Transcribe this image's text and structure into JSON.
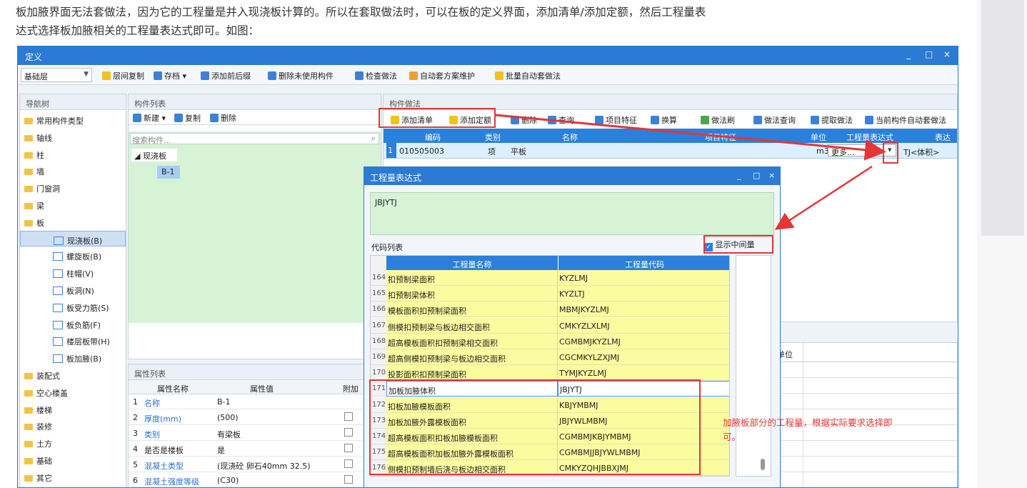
{
  "intro": {
    "line1": "板加腋界面无法套做法，因为它的工程量是并入现浇板计算的。所以在套取做法时，可以在板的定义界面，添加清单/添加定额，然后工程量表",
    "line2": "达式选择板加腋相关的工程量表达式即可。如图："
  },
  "window": {
    "title": "定义",
    "controls": [
      "_",
      "□",
      "×"
    ]
  },
  "toolbar": {
    "floor": "基础层",
    "items": [
      "层间复制",
      "存档",
      "添加前后缀",
      "删除未使用构件",
      "检查做法",
      "自动套方案维护",
      "批量自动套做法"
    ]
  },
  "nav": {
    "title": "导航树",
    "items": [
      {
        "label": "常用构件类型",
        "level": 0
      },
      {
        "label": "轴线",
        "level": 0
      },
      {
        "label": "柱",
        "level": 0
      },
      {
        "label": "墙",
        "level": 0
      },
      {
        "label": "门窗洞",
        "level": 0
      },
      {
        "label": "梁",
        "level": 0
      },
      {
        "label": "板",
        "level": 0
      },
      {
        "label": "现浇板(B)",
        "level": 1,
        "selected": true
      },
      {
        "label": "螺旋板(B)",
        "level": 1
      },
      {
        "label": "柱帽(V)",
        "level": 1
      },
      {
        "label": "板洞(N)",
        "level": 1
      },
      {
        "label": "板受力筋(S)",
        "level": 1
      },
      {
        "label": "板负筋(F)",
        "level": 1
      },
      {
        "label": "楼层板带(H)",
        "level": 1
      },
      {
        "label": "板加腋(B)",
        "level": 1
      },
      {
        "label": "装配式",
        "level": 0
      },
      {
        "label": "空心楼盖",
        "level": 0
      },
      {
        "label": "楼梯",
        "level": 0
      },
      {
        "label": "装修",
        "level": 0
      },
      {
        "label": "土方",
        "level": 0
      },
      {
        "label": "基础",
        "level": 0
      },
      {
        "label": "其它",
        "level": 0
      }
    ]
  },
  "complist": {
    "title": "构件列表",
    "new": "新建",
    "copy": "复制",
    "delete": "删除",
    "search_placeholder": "搜索构件...",
    "group": "现浇板",
    "item": "B-1"
  },
  "props": {
    "title": "属性列表",
    "headers": [
      "属性名称",
      "属性值",
      "附加"
    ],
    "rows": [
      {
        "no": "1",
        "name": "名称",
        "value": "B-1",
        "link": true,
        "check": false
      },
      {
        "no": "2",
        "name": "厚度(mm)",
        "value": "(500)",
        "link": true,
        "check": true
      },
      {
        "no": "3",
        "name": "类别",
        "value": "有梁板",
        "link": true,
        "check": true
      },
      {
        "no": "4",
        "name": "是否是楼板",
        "value": "是",
        "link": false,
        "check": true
      },
      {
        "no": "5",
        "name": "混凝土类型",
        "value": "(现浇砼 卵石40mm 32.5)",
        "link": true,
        "check": true
      },
      {
        "no": "6",
        "name": "混凝土强度等级",
        "value": "(C30)",
        "link": true,
        "check": true
      }
    ]
  },
  "method": {
    "title": "构件做法",
    "toolbar": [
      "添加清单",
      "添加定额",
      "删除",
      "查询",
      "项目特征",
      "换算",
      "做法刷",
      "做法查询",
      "提取做法",
      "当前构件自动套做法"
    ],
    "headers": [
      "编码",
      "类别",
      "名称",
      "项目特征",
      "单位",
      "工程量表达式",
      "表达式"
    ],
    "row": {
      "no": "1",
      "code": "010505003",
      "type": "项",
      "name": "平板",
      "unit": "m3",
      "expr": "更多...",
      "expr_desc": "TJ<体积>"
    },
    "lower_header": "单位"
  },
  "dialog": {
    "title": "工程量表达式",
    "expr": "JBJYTJ",
    "list_label": "代码列表",
    "show_mid": "显示中间量",
    "headers": [
      "工程量名称",
      "工程量代码"
    ],
    "rows": [
      {
        "no": "164",
        "name": "扣预制梁面积",
        "code": "KYZLMJ"
      },
      {
        "no": "165",
        "name": "扣预制梁体积",
        "code": "KYZLTJ"
      },
      {
        "no": "166",
        "name": "模板面积扣预制梁面积",
        "code": "MBMJKYZLMJ"
      },
      {
        "no": "167",
        "name": "侧模扣预制梁与板边相交面积",
        "code": "CMKYZLXLMJ"
      },
      {
        "no": "168",
        "name": "超高模板面积扣预制梁相交面积",
        "code": "CGMBMJKYZLMJ"
      },
      {
        "no": "169",
        "name": "超高侧模扣预制梁与板边相交面积",
        "code": "CGCMKYLZXJMJ"
      },
      {
        "no": "170",
        "name": "投影面积扣预制梁面积",
        "code": "TYMJKYZLMJ"
      },
      {
        "no": "171",
        "name": "加板加腋体积",
        "code": "JBJYTJ",
        "selected": true
      },
      {
        "no": "172",
        "name": "扣板加腋模板面积",
        "code": "KBJYMBMJ"
      },
      {
        "no": "173",
        "name": "加板加腋外露模板面积",
        "code": "JBJYWLMBMJ"
      },
      {
        "no": "174",
        "name": "超高模板面积扣板加腋模板面积",
        "code": "CGMBMJKBJYMBMJ"
      },
      {
        "no": "175",
        "name": "超高模板面积加板加腋外露模板面积",
        "code": "CGMBMJJBJYWLMBMJ"
      },
      {
        "no": "176",
        "name": "侧模扣预制墙后浇与板边相交面积",
        "code": "CMKYZQHJBBXJMJ"
      }
    ]
  },
  "annotation": {
    "line1": "加腋板部分的工程量，根据实际要求选择即",
    "line2": "可。"
  },
  "colors": {
    "title_bar": "#2b7ad3",
    "highlight": "#e53535",
    "list_cell": "#fbfba0",
    "green_panel": "#d6f3d6"
  }
}
